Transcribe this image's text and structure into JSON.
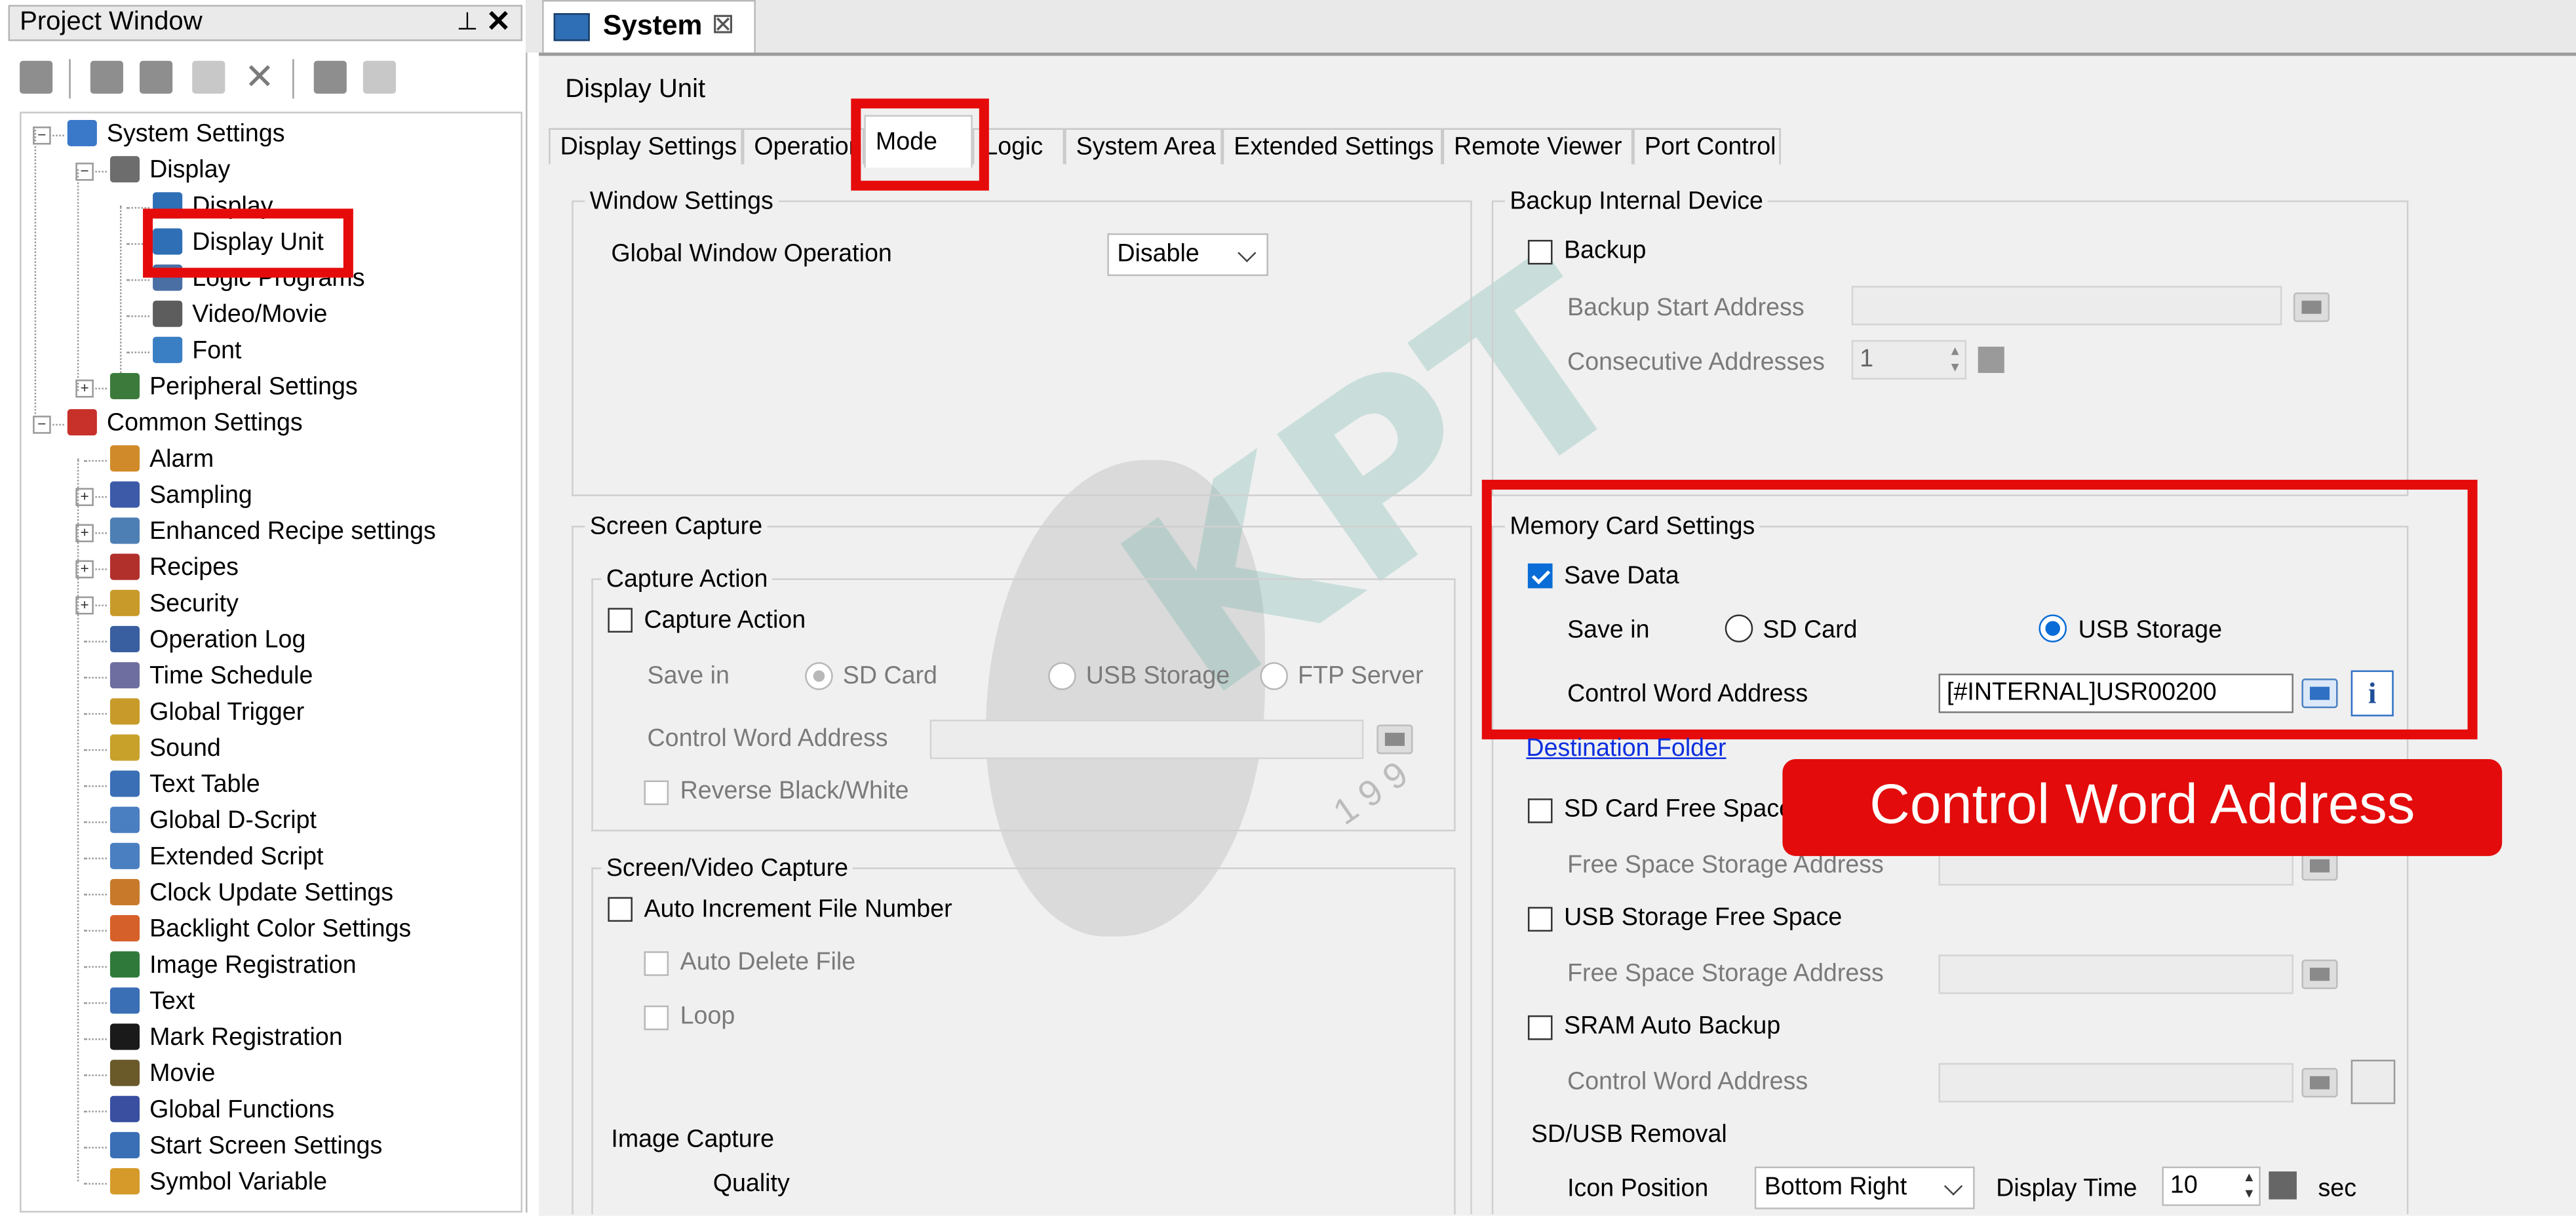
{
  "project_window": {
    "title": "Project Window",
    "pin_glyph": "⊥",
    "close_glyph": "✕",
    "tree": [
      {
        "label": "System Settings",
        "level": 0,
        "expander": "minus",
        "icon": "monitor-icon"
      },
      {
        "label": "Display",
        "level": 1,
        "expander": "minus",
        "icon": "camera-icon"
      },
      {
        "label": "Display",
        "level": 2,
        "icon": "display-icon"
      },
      {
        "label": "Display Unit",
        "level": 2,
        "icon": "display-unit-icon"
      },
      {
        "label": "Logic Programs",
        "level": 2,
        "icon": "logic-icon"
      },
      {
        "label": "Video/Movie",
        "level": 2,
        "icon": "film-icon"
      },
      {
        "label": "Font",
        "level": 2,
        "icon": "font-icon"
      },
      {
        "label": "Peripheral Settings",
        "level": 1,
        "expander": "plus",
        "icon": "peripheral-icon"
      },
      {
        "label": "Common Settings",
        "level": 0,
        "expander": "minus",
        "icon": "book-icon"
      },
      {
        "label": "Alarm",
        "level": 1,
        "icon": "alarm-icon"
      },
      {
        "label": "Sampling",
        "level": 1,
        "expander": "plus",
        "icon": "sampling-icon"
      },
      {
        "label": "Enhanced Recipe settings",
        "level": 1,
        "expander": "plus",
        "icon": "recipe-icon"
      },
      {
        "label": "Recipes",
        "level": 1,
        "expander": "plus",
        "icon": "recipes-icon"
      },
      {
        "label": "Security",
        "level": 1,
        "expander": "plus",
        "icon": "key-icon"
      },
      {
        "label": "Operation Log",
        "level": 1,
        "icon": "log-icon"
      },
      {
        "label": "Time Schedule",
        "level": 1,
        "icon": "clock-icon"
      },
      {
        "label": "Global Trigger",
        "level": 1,
        "icon": "trigger-icon"
      },
      {
        "label": "Sound",
        "level": 1,
        "icon": "speaker-icon"
      },
      {
        "label": "Text Table",
        "level": 1,
        "icon": "text-table-icon"
      },
      {
        "label": "Global D-Script",
        "level": 1,
        "icon": "script-icon"
      },
      {
        "label": "Extended Script",
        "level": 1,
        "icon": "extended-script-icon"
      },
      {
        "label": "Clock Update Settings",
        "level": 1,
        "icon": "clock-update-icon"
      },
      {
        "label": "Backlight Color Settings",
        "level": 1,
        "icon": "backlight-icon"
      },
      {
        "label": "Image Registration",
        "level": 1,
        "icon": "image-icon"
      },
      {
        "label": "Text",
        "level": 1,
        "icon": "text-icon"
      },
      {
        "label": "Mark Registration",
        "level": 1,
        "icon": "mark-icon"
      },
      {
        "label": "Movie",
        "level": 1,
        "icon": "movie-icon"
      },
      {
        "label": "Global Functions",
        "level": 1,
        "icon": "functions-icon"
      },
      {
        "label": "Start Screen Settings",
        "level": 1,
        "icon": "start-screen-icon"
      },
      {
        "label": "Symbol Variable",
        "level": 1,
        "icon": "symbol-icon"
      }
    ]
  },
  "document_tab": {
    "label": "System",
    "close_glyph": "⊠"
  },
  "panel_title": "Display Unit",
  "tabs": [
    "Display Settings",
    "Operation",
    "Mode",
    "Logic",
    "System Area",
    "Extended Settings",
    "Remote Viewer",
    "Port Control"
  ],
  "active_tab": "Mode",
  "window_settings": {
    "title": "Window Settings",
    "global_window_operation_label": "Global Window Operation",
    "global_window_operation_value": "Disable"
  },
  "screen_capture": {
    "title": "Screen Capture",
    "capture_action_group": "Capture Action",
    "capture_action_checkbox": "Capture Action",
    "save_in_label": "Save in",
    "save_in_options": [
      "SD Card",
      "USB Storage",
      "FTP Server"
    ],
    "control_word_address_label": "Control Word Address",
    "reverse_bw": "Reverse Black/White"
  },
  "screen_video_capture": {
    "title": "Screen/Video Capture",
    "auto_increment": "Auto Increment File Number",
    "auto_delete": "Auto Delete File",
    "loop": "Loop",
    "image_capture": "Image Capture",
    "quality": "Quality"
  },
  "backup": {
    "title": "Backup Internal Device",
    "backup_checkbox": "Backup",
    "start_address_label": "Backup Start Address",
    "consecutive_label": "Consecutive Addresses",
    "consecutive_value": "1"
  },
  "memory_card": {
    "title": "Memory Card Settings",
    "save_data": "Save Data",
    "save_in_label": "Save in",
    "sd_card": "SD Card",
    "usb_storage": "USB Storage",
    "control_word_address_label": "Control Word Address",
    "control_word_address_value": "[#INTERNAL]USR00200",
    "destination_folder": "Destination Folder",
    "sd_free_space": "SD Card Free Space",
    "free_space_address_1": "Free Space Storage Address",
    "usb_free_space": "USB Storage Free Space",
    "free_space_address_2": "Free Space Storage Address",
    "sram_auto_backup": "SRAM Auto Backup",
    "sram_control_word_label": "Control Word Address",
    "removal_title": "SD/USB Removal",
    "icon_position_label": "Icon Position",
    "icon_position_value": "Bottom Right",
    "display_time_label": "Display Time",
    "display_time_value": "10",
    "display_time_unit": "sec"
  },
  "callout": "Control Word Address",
  "watermark": {
    "text": "KPT",
    "digits": "1 9 9"
  },
  "colors": {
    "highlight_red": "#e60b0b",
    "check_blue": "#0a6cd6",
    "link_blue": "#0b2ee0"
  }
}
